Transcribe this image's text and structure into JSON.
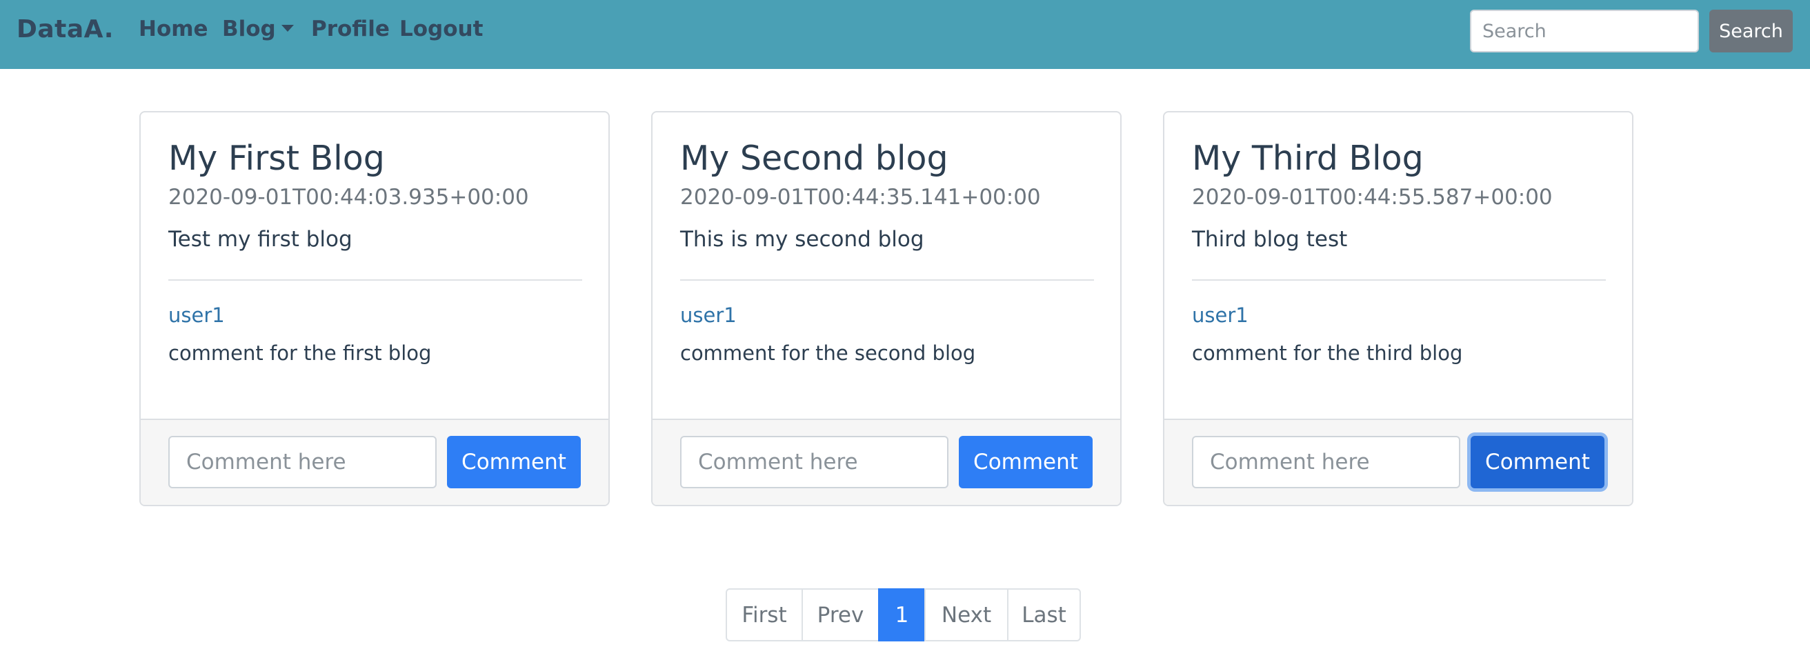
{
  "navbar": {
    "brand": "DataA.",
    "items": [
      {
        "label": "Home"
      },
      {
        "label": "Blog"
      },
      {
        "label": "Profile"
      },
      {
        "label": "Logout"
      }
    ],
    "search": {
      "placeholder": "Search",
      "button_label": "Search"
    }
  },
  "cards": [
    {
      "title": "My First Blog",
      "date": "2020-09-01T00:44:03.935+00:00",
      "body": "Test my first blog",
      "comment_user": "user1",
      "comment_text": "comment for the first blog",
      "input_placeholder": "Comment here",
      "button_label": "Comment"
    },
    {
      "title": "My Second blog",
      "date": "2020-09-01T00:44:35.141+00:00",
      "body": "This is my second blog",
      "comment_user": "user1",
      "comment_text": "comment for the second blog",
      "input_placeholder": "Comment here",
      "button_label": "Comment"
    },
    {
      "title": "My Third Blog",
      "date": "2020-09-01T00:44:55.587+00:00",
      "body": "Third blog test",
      "comment_user": "user1",
      "comment_text": "comment for the third blog",
      "input_placeholder": "Comment here",
      "button_label": "Comment"
    }
  ],
  "pagination": {
    "first": "First",
    "prev": "Prev",
    "current": "1",
    "next": "Next",
    "last": "Last"
  },
  "colors": {
    "navbar": "#4aa0b5",
    "primary": "#2e7ef5",
    "link": "#2f73a8",
    "secondary": "#6c757d"
  }
}
